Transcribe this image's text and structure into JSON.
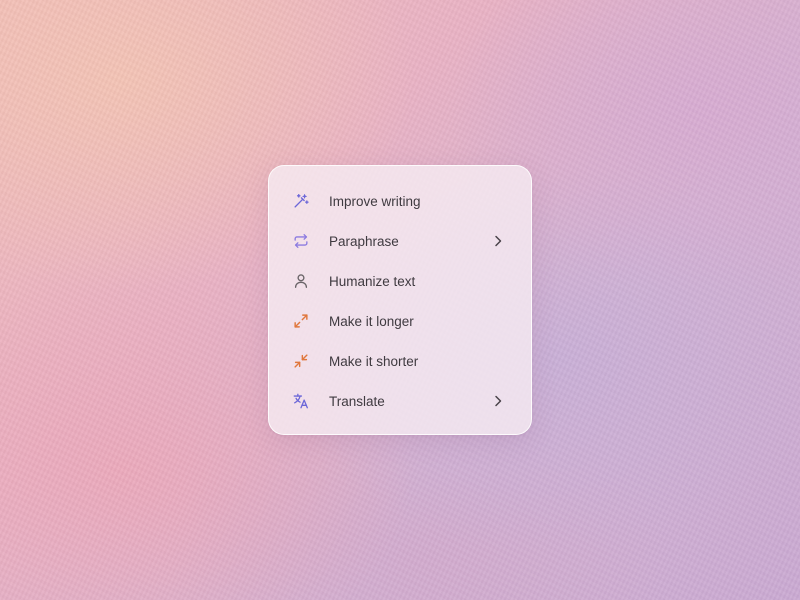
{
  "menu": {
    "items": [
      {
        "label": "Improve writing",
        "icon": "magic-wand-icon",
        "icon_color": "#6c67d8",
        "has_submenu": false
      },
      {
        "label": "Paraphrase",
        "icon": "repeat-arrows-icon",
        "icon_color": "#8c7be0",
        "has_submenu": true
      },
      {
        "label": "Humanize text",
        "icon": "person-icon",
        "icon_color": "#6a6468",
        "has_submenu": false
      },
      {
        "label": "Make it longer",
        "icon": "expand-arrows-icon",
        "icon_color": "#e0773c",
        "has_submenu": false
      },
      {
        "label": "Make it shorter",
        "icon": "collapse-arrows-icon",
        "icon_color": "#e0773c",
        "has_submenu": false
      },
      {
        "label": "Translate",
        "icon": "translate-icon",
        "icon_color": "#6c67d8",
        "has_submenu": true
      }
    ]
  }
}
